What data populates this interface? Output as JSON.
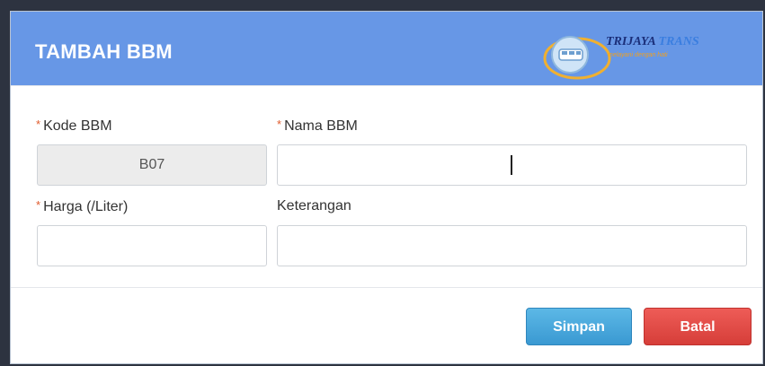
{
  "modal": {
    "title": "TAMBAH BBM",
    "logo": {
      "brand_primary": "TRIJAYA",
      "brand_secondary": "TRANS",
      "tagline": "melayani dengan hati"
    }
  },
  "form": {
    "required_marker": "*",
    "kode_bbm": {
      "label": "Kode BBM",
      "value": "B07",
      "required": true,
      "readonly": true
    },
    "nama_bbm": {
      "label": "Nama BBM",
      "value": "",
      "required": true
    },
    "harga": {
      "label": "Harga (/Liter)",
      "value": "",
      "required": true
    },
    "keterangan": {
      "label": "Keterangan",
      "value": "",
      "required": false
    }
  },
  "buttons": {
    "save_label": "Simpan",
    "cancel_label": "Batal"
  },
  "colors": {
    "header": "#6797e6",
    "save": "#3a99d2",
    "cancel": "#d63e39",
    "required": "#e05a2c"
  }
}
